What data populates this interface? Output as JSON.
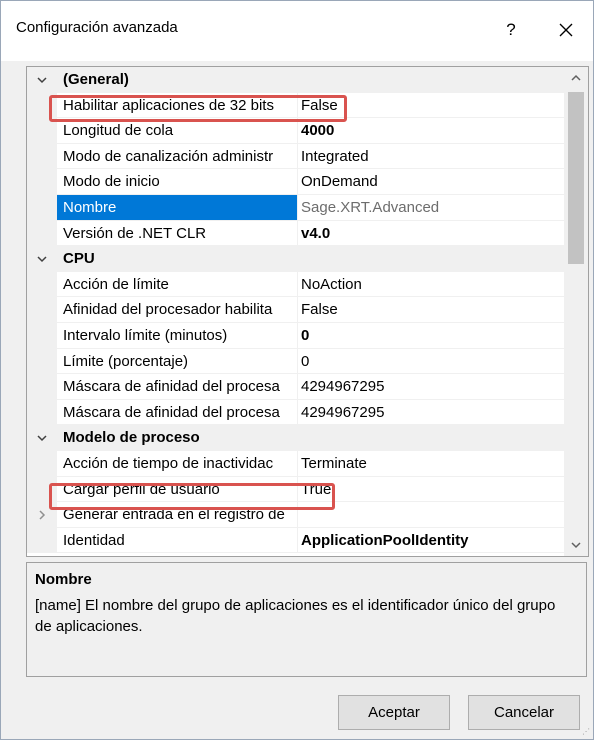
{
  "window": {
    "title": "Configuración avanzada",
    "help_label": "?"
  },
  "grid": {
    "rows": [
      {
        "kind": "category",
        "name": "(General)",
        "expanded": true
      },
      {
        "kind": "property",
        "name": "Habilitar aplicaciones de 32 bits",
        "value": "False",
        "highlighted": true
      },
      {
        "kind": "property",
        "name": "Longitud de cola",
        "value": "4000",
        "value_bold": true
      },
      {
        "kind": "property",
        "name": "Modo de canalización administr",
        "value": "Integrated"
      },
      {
        "kind": "property",
        "name": "Modo de inicio",
        "value": "OnDemand"
      },
      {
        "kind": "property",
        "name": "Nombre",
        "value": "Sage.XRT.Advanced",
        "selected": true,
        "value_gray": true
      },
      {
        "kind": "property",
        "name": "Versión de .NET CLR",
        "value": "v4.0",
        "value_bold": true
      },
      {
        "kind": "category",
        "name": "CPU",
        "expanded": true
      },
      {
        "kind": "property",
        "name": "Acción de límite",
        "value": "NoAction"
      },
      {
        "kind": "property",
        "name": "Afinidad del procesador habilita",
        "value": "False"
      },
      {
        "kind": "property",
        "name": "Intervalo límite (minutos)",
        "value": "0",
        "value_bold": true
      },
      {
        "kind": "property",
        "name": "Límite (porcentaje)",
        "value": "0"
      },
      {
        "kind": "property",
        "name": "Máscara de afinidad del procesa",
        "value": "4294967295"
      },
      {
        "kind": "property",
        "name": "Máscara de afinidad del procesa",
        "value": "4294967295"
      },
      {
        "kind": "category",
        "name": "Modelo de proceso",
        "expanded": true
      },
      {
        "kind": "property",
        "name": "Acción de tiempo de inactividac",
        "value": "Terminate"
      },
      {
        "kind": "property",
        "name": "Cargar perfil de usuario",
        "value": "True",
        "highlighted": true
      },
      {
        "kind": "property",
        "name": "Generar entrada en el registro de",
        "value": "",
        "expandable": true
      },
      {
        "kind": "property",
        "name": "Identidad",
        "value": "ApplicationPoolIdentity",
        "value_bold": true
      }
    ]
  },
  "description": {
    "title": "Nombre",
    "text": "[name] El nombre del grupo de aplicaciones es el identificador único del grupo de aplicaciones."
  },
  "buttons": {
    "accept": "Aceptar",
    "cancel": "Cancelar"
  },
  "colors": {
    "selection": "#0078d7",
    "highlight_border": "#d9534f",
    "gutter": "#f0f0f0"
  }
}
